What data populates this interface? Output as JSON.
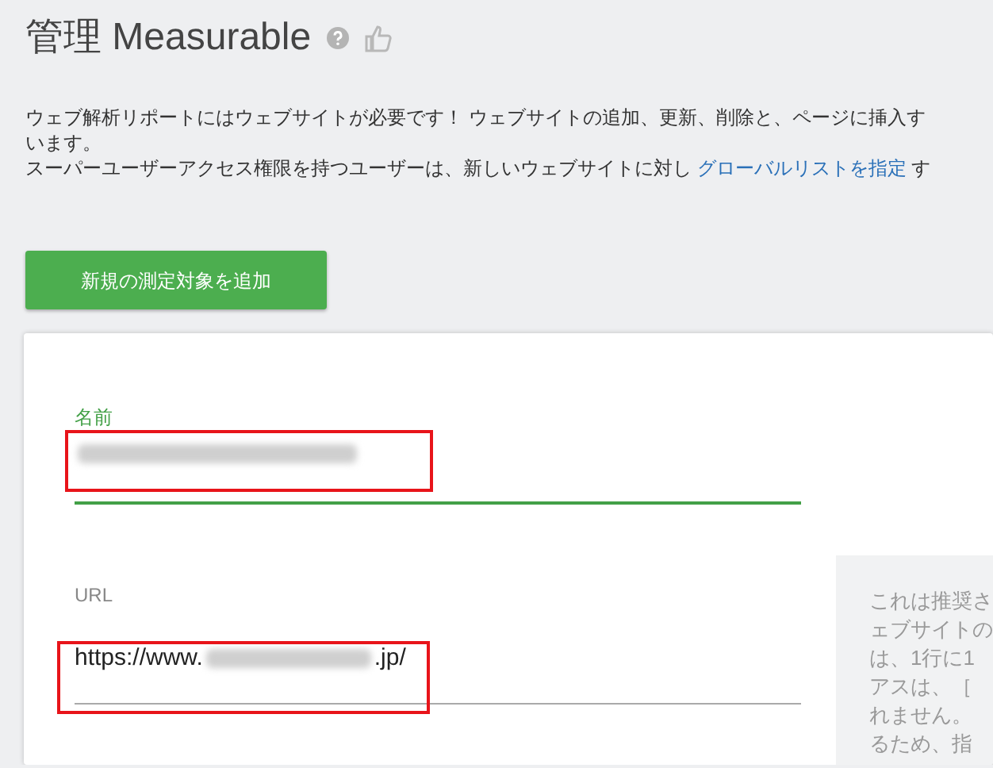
{
  "header": {
    "title": "管理 Measurable"
  },
  "intro": {
    "lines": [
      "ウェブ解析リポートにはウェブサイトが必要です！ ウェブサイトの追加、更新、削除と、ページに挿入す",
      "います。"
    ],
    "line_3": {
      "before": "スーパーユーザーアクセス権限を持つユーザーは、新しいウェブサイトに対し ",
      "link": "グローバルリストを指定",
      "after": " す"
    }
  },
  "add_button": {
    "label": "新規の測定対象を追加"
  },
  "form": {
    "fields": [
      {
        "label": "名前",
        "focused": true,
        "highlighted": true
      },
      {
        "label": "URL",
        "focused": false,
        "value_before": "https://www.",
        "value_after": ".jp/",
        "highlighted": true
      }
    ],
    "help_lines": [
      "これは推奨さ",
      "ェブサイトの",
      "は、1行に1",
      "アスは、［",
      "れません。",
      "るため、指"
    ]
  }
}
